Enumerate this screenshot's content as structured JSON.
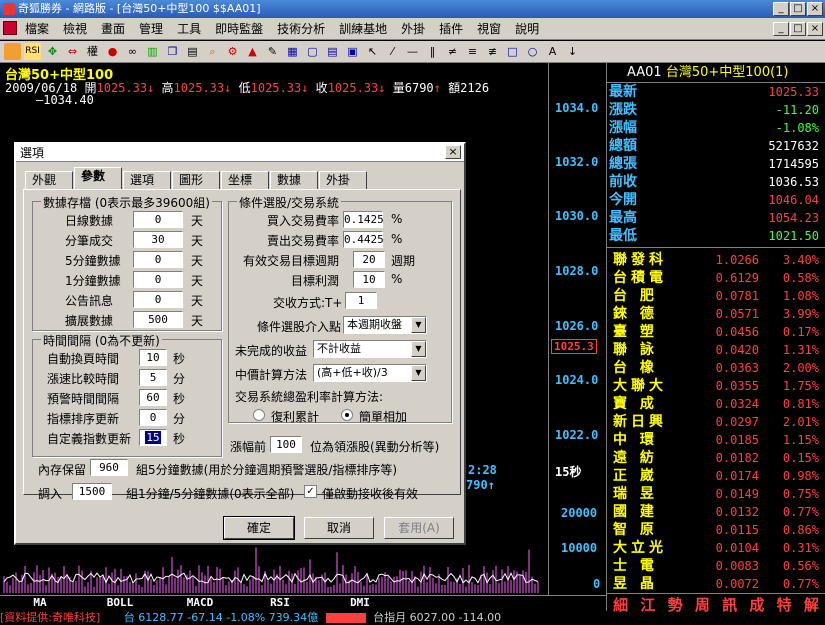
{
  "window": {
    "title": "奇狐勝券 - 網路版 - [台灣50+中型100 $$AA01]",
    "buttons": [
      "_",
      "□",
      "×"
    ],
    "mdi_buttons": [
      "_",
      "□",
      "×"
    ]
  },
  "menu": [
    "檔案",
    "檢視",
    "畫面",
    "管理",
    "工具",
    "即時監盤",
    "技術分析",
    "訓練基地",
    "外掛",
    "插件",
    "視窗",
    "說明"
  ],
  "toolbar": {
    "rsi_label": "RSI",
    "weight_label": "權"
  },
  "chart": {
    "symbol": "台灣50+中型100",
    "date": "2009/06/18",
    "open_label": "開",
    "open": "1025.33",
    "high_label": "高",
    "high": "1025.33",
    "low_label": "低",
    "low": "1025.33",
    "close_label": "收",
    "close": "1025.33",
    "vol_label": "量",
    "vol": "6790",
    "amt_label": "額",
    "amt": "2126",
    "ma_value": "—1034.40",
    "y_ticks": [
      "1034.0",
      "1032.0",
      "1030.0",
      "1028.0",
      "1026.0",
      "1024.0",
      "1022.0"
    ],
    "current_price": "1025.3",
    "time_readout": "2:28",
    "interval_label": "15秒",
    "vol_readout": "790",
    "vol_ticks": [
      "20000",
      "10000",
      "0"
    ],
    "bottom_tabs": [
      "MA",
      "BOLL",
      "MACD",
      "RSI",
      "DMI"
    ]
  },
  "status": {
    "provider": "[資料提供:奇唯科技]",
    "index_text": "台 6128.77 -67.14 -1.08% 739.34億",
    "market_text": "台指月 6027.00 -114.00"
  },
  "quote": {
    "code": "AA01",
    "name": "台灣50+中型100(1)",
    "rows": [
      {
        "label": "最新",
        "value": "1025.33",
        "color": "#ff4040"
      },
      {
        "label": "漲跌",
        "value": "-11.20",
        "color": "#40ff40"
      },
      {
        "label": "漲幅",
        "value": "-1.08%",
        "color": "#40ff40"
      },
      {
        "label": "總額",
        "value": "5217632",
        "color": "#ffffff"
      },
      {
        "label": "總張",
        "value": "1714595",
        "color": "#ffffff"
      },
      {
        "label": "前收",
        "value": "1036.53",
        "color": "#ffffff"
      },
      {
        "label": "今開",
        "value": "1046.04",
        "color": "#ff4040"
      },
      {
        "label": "最高",
        "value": "1054.23",
        "color": "#ff4040"
      },
      {
        "label": "最低",
        "value": "1021.50",
        "color": "#40ff40"
      }
    ],
    "stocks": [
      {
        "name": "聯發科",
        "price": "1.0266",
        "pct": "3.40%"
      },
      {
        "name": "台積電",
        "price": "0.6129",
        "pct": "0.58%"
      },
      {
        "name": "台 肥",
        "price": "0.0781",
        "pct": "1.08%"
      },
      {
        "name": "錸 德",
        "price": "0.0571",
        "pct": "3.99%"
      },
      {
        "name": "臺 塑",
        "price": "0.0456",
        "pct": "0.17%"
      },
      {
        "name": "聯 詠",
        "price": "0.0420",
        "pct": "1.31%"
      },
      {
        "name": "台 橡",
        "price": "0.0363",
        "pct": "2.00%"
      },
      {
        "name": "大聯大",
        "price": "0.0355",
        "pct": "1.75%"
      },
      {
        "name": "寶 成",
        "price": "0.0324",
        "pct": "0.81%"
      },
      {
        "name": "新日興",
        "price": "0.0297",
        "pct": "2.01%"
      },
      {
        "name": "中 環",
        "price": "0.0185",
        "pct": "1.15%"
      },
      {
        "name": "遠 紡",
        "price": "0.0182",
        "pct": "0.15%"
      },
      {
        "name": "正 崴",
        "price": "0.0174",
        "pct": "0.98%"
      },
      {
        "name": "瑞 昱",
        "price": "0.0149",
        "pct": "0.75%"
      },
      {
        "name": "國 建",
        "price": "0.0132",
        "pct": "0.77%"
      },
      {
        "name": "智 原",
        "price": "0.0115",
        "pct": "0.86%"
      },
      {
        "name": "大立光",
        "price": "0.0104",
        "pct": "0.31%"
      },
      {
        "name": "士 電",
        "price": "0.0083",
        "pct": "0.56%"
      },
      {
        "name": "昱 晶",
        "price": "0.0072",
        "pct": "0.77%"
      }
    ],
    "tabs": [
      "細",
      "江",
      "勢",
      "周",
      "訊",
      "成",
      "特",
      "解"
    ]
  },
  "dialog": {
    "title": "選項",
    "close": "×",
    "tabs": [
      "外觀",
      "參數",
      "選項",
      "圖形",
      "坐標",
      "數據",
      "外掛"
    ],
    "storage": {
      "title": "數據存檔 (0表示最多39600組)",
      "rows": [
        {
          "label": "日線數據",
          "value": "0",
          "unit": "天"
        },
        {
          "label": "分筆成交",
          "value": "30",
          "unit": "天"
        },
        {
          "label": "5分鐘數據",
          "value": "0",
          "unit": "天"
        },
        {
          "label": "1分鐘數據",
          "value": "0",
          "unit": "天"
        },
        {
          "label": "公告訊息",
          "value": "0",
          "unit": "天"
        },
        {
          "label": "擴展數據",
          "value": "500",
          "unit": "天"
        }
      ]
    },
    "interval": {
      "title": "時間間隔 (0為不更新)",
      "rows": [
        {
          "label": "自動換頁時間",
          "value": "10",
          "unit": "秒"
        },
        {
          "label": "漲速比較時間",
          "value": "5",
          "unit": "分"
        },
        {
          "label": "預警時間間隔",
          "value": "60",
          "unit": "秒"
        },
        {
          "label": "指標排序更新",
          "value": "0",
          "unit": "分"
        },
        {
          "label": "自定義指數更新",
          "value": "15",
          "unit": "秒"
        }
      ]
    },
    "system": {
      "title": "條件選股/交易系統",
      "buy_fee_label": "買入交易費率",
      "buy_fee": "0.1425",
      "pct": "%",
      "sell_fee_label": "賣出交易費率",
      "sell_fee": "0.4425",
      "period_label": "有效交易目標週期",
      "period": "20",
      "period_unit": "週期",
      "target_label": "目標利潤",
      "target": "10",
      "settle_label": "交收方式:T+",
      "settle": "1",
      "entry_label": "條件選股介入點",
      "entry": "本週期收盤",
      "unfinished_label": "未完成的收益",
      "unfinished": "不計收益",
      "mid_label": "中價計算方法",
      "mid": "(高+低+收)/3",
      "profit_label": "交易系統總盈利率計算方法:",
      "radio1": "復利累計",
      "radio2": "簡單相加"
    },
    "leader_label": "漲幅前",
    "leader_value": "100",
    "leader_suffix": "位為領漲股(異動分析等)",
    "memory_label": "內存保留",
    "memory_value": "960",
    "memory_suffix": "組5分鐘數據(用於分鐘週期預警選股/指標排序等)",
    "load_label": "調入",
    "load_value": "1500",
    "load_suffix": "組1分鐘/5分鐘數據(0表示全部)",
    "check_label": "僅啟動接收後有效",
    "ok": "確定",
    "cancel": "取消",
    "apply": "套用(A)"
  }
}
